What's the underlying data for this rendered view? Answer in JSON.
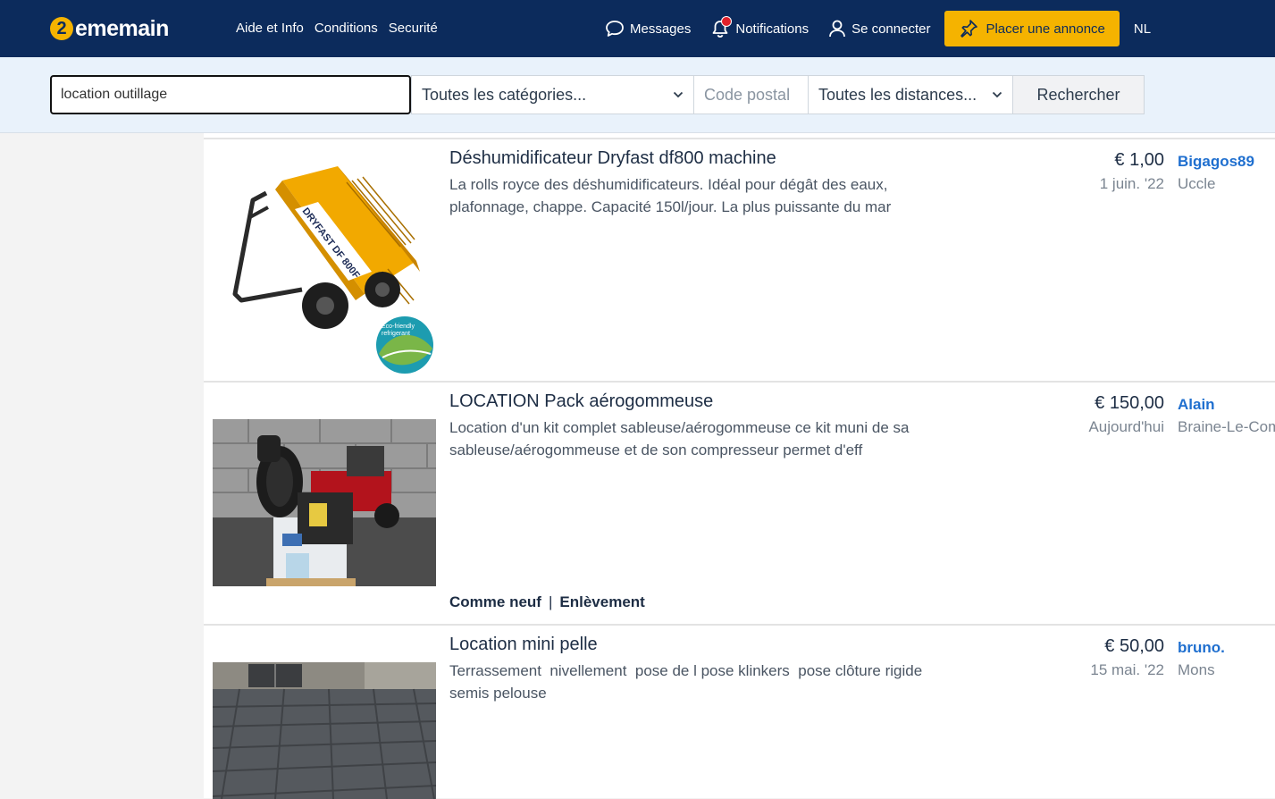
{
  "header": {
    "logo_number": "2",
    "logo_text": "ememain",
    "nav": [
      "Aide et Info",
      "Conditions",
      "Securité"
    ],
    "messages": "Messages",
    "notifications": "Notifications",
    "login": "Se connecter",
    "place_ad": "Placer une annonce",
    "lang": "NL"
  },
  "search": {
    "query": "location outillage",
    "category": "Toutes les catégories...",
    "postal_placeholder": "Code postal",
    "distance": "Toutes les distances...",
    "button": "Rechercher"
  },
  "listings": [
    {
      "title": "Déshumidificateur Dryfast df800 machine",
      "description": "La rolls royce des déshumidificateurs. Idéal pour dégât des eaux, plafonnage, chappe. Capacité 150l/jour. La plus puissante du mar",
      "price": "€ 1,00",
      "date": "1 juin. '22",
      "seller": "Bigagos89",
      "location": "Uccle",
      "image_text": {
        "brand": "DRYFAST DF 800F",
        "badge_line1": "Eco-friendly",
        "badge_line2": "refrigerant"
      }
    },
    {
      "title": "LOCATION Pack aérogommeuse",
      "description": "Location d'un kit complet sableuse/aérogommeuse ce kit muni de sa sableuse/aérogommeuse et de son compresseur permet d'eff",
      "price": "€ 150,00",
      "date": "Aujourd'hui",
      "seller": "Alain",
      "location": "Braine-Le-Comte",
      "tags": [
        "Comme neuf",
        "Enlèvement"
      ]
    },
    {
      "title": "Location mini pelle",
      "description": "Terrassement  nivellement  pose de l pose klinkers  pose clôture rigide  semis pelouse",
      "price": "€ 50,00",
      "date": "15 mai. '22",
      "seller": "bruno.",
      "location": "Mons"
    }
  ],
  "colors": {
    "header_bg": "#0c2b5c",
    "accent": "#f5b300",
    "seller_link": "#1f6fcf"
  }
}
